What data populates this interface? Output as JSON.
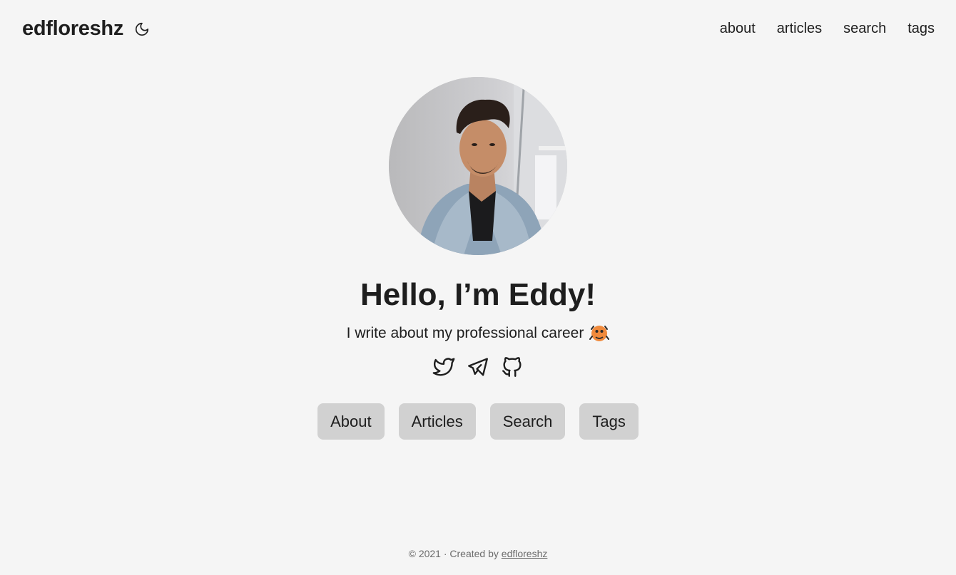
{
  "header": {
    "brand": "edfloreshz",
    "theme_icon": "moon-icon",
    "nav": [
      {
        "label": "about"
      },
      {
        "label": "articles"
      },
      {
        "label": "search"
      },
      {
        "label": "tags"
      }
    ]
  },
  "hero": {
    "avatar_alt": "profile-photo",
    "greeting": "Hello, I’m Eddy!",
    "tagline": "I write about my professional career",
    "tagline_icon": "crab-icon",
    "socials": [
      {
        "icon": "twitter-icon"
      },
      {
        "icon": "telegram-icon"
      },
      {
        "icon": "github-icon"
      }
    ],
    "buttons": [
      {
        "label": "About"
      },
      {
        "label": "Articles"
      },
      {
        "label": "Search"
      },
      {
        "label": "Tags"
      }
    ]
  },
  "footer": {
    "copyright": "© 2021 · Created by",
    "author_link": "edfloreshz"
  },
  "colors": {
    "background": "#f5f5f5",
    "text": "#1e1e1e",
    "button_bg": "#d1d1d1",
    "footer_text": "#6b6b6b"
  }
}
